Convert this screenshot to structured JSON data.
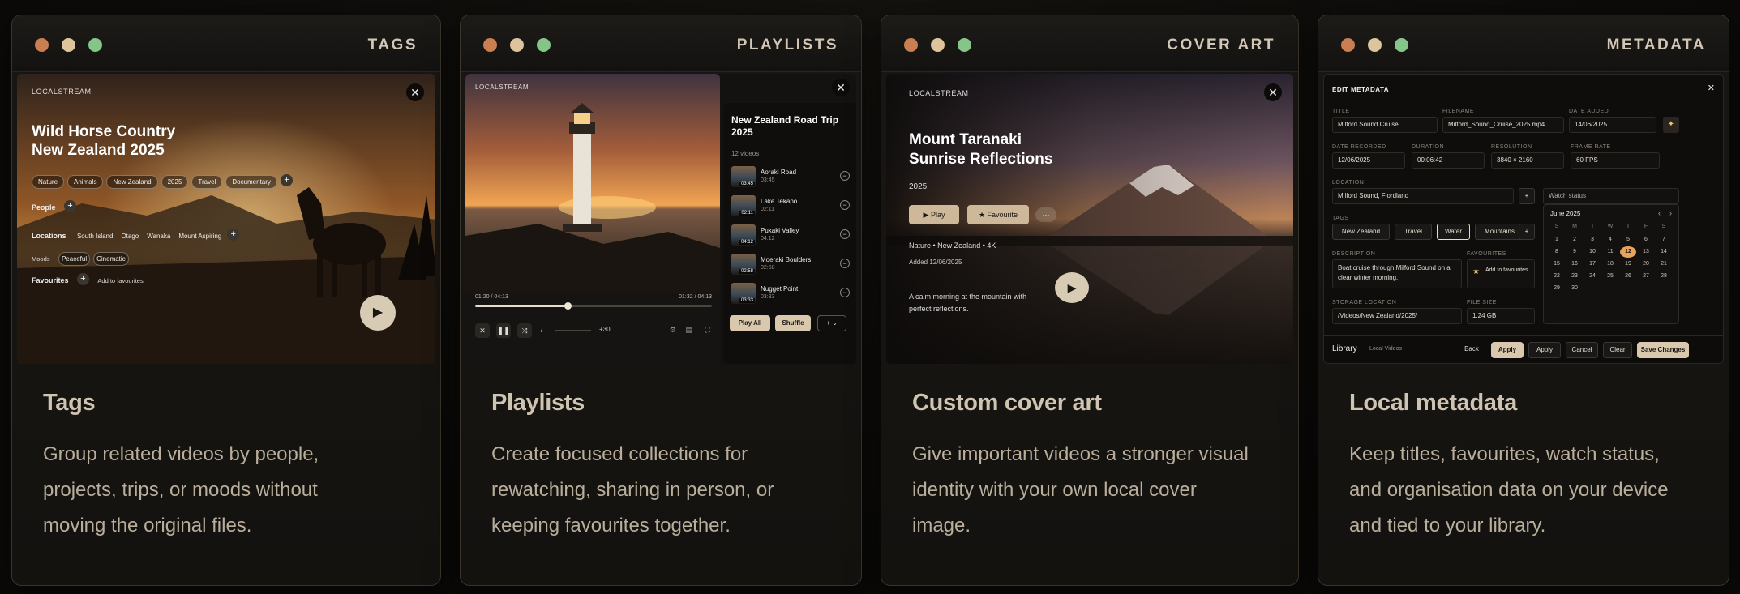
{
  "cards": {
    "tags": {
      "window_title": "TAGS",
      "heading": "Tags",
      "description": "Group related videos by people, projects, trips, or moods without moving the original files.",
      "app_name": "LOCALSTREAM",
      "video_title_line1": "Wild Horse Country",
      "video_title_line2": "New Zealand 2025",
      "tag_chips": [
        "Nature",
        "Animals",
        "New Zealand",
        "2025",
        "Travel",
        "Documentary"
      ],
      "people_label": "People",
      "locations_label": "Locations",
      "locations": [
        "South Island",
        "Otago",
        "Wanaka",
        "Mount Aspiring"
      ],
      "moods_label": "Moods",
      "moods": [
        "Peaceful",
        "Cinematic"
      ],
      "favourites_label": "Favourites",
      "add_to_favourites": "Add to favourites",
      "close_glyph": "✕",
      "plus_glyph": "+",
      "play_glyph": "▶"
    },
    "playlists": {
      "window_title": "PLAYLISTS",
      "heading": "Playlists",
      "description": "Create focused collections for rewatching, sharing in person, or keeping favourites together.",
      "app_name": "LOCALSTREAM",
      "playlist_title_line1": "New Zealand Road Trip",
      "playlist_title_line2": "2025",
      "video_count": "12 videos",
      "items": [
        {
          "name": "Aoraki Road",
          "duration": "03:45",
          "badge": "03:45"
        },
        {
          "name": "Lake Tekapo",
          "duration": "02:11",
          "badge": "02:11"
        },
        {
          "name": "Pukaki Valley",
          "duration": "04:12",
          "badge": "04:12"
        },
        {
          "name": "Moeraki Boulders",
          "duration": "02:58",
          "badge": "02:58"
        },
        {
          "name": "Nugget Point",
          "duration": "03:33",
          "badge": "03:33"
        }
      ],
      "time_current": "01:20 / 04:13",
      "time_right": "01:32 / 04:13",
      "progress_fraction": 0.39,
      "skip_label": "+30",
      "play_all": "Play All",
      "shuffle": "Shuffle",
      "more_label": "+ ⌄",
      "close_glyph": "✕",
      "minus_glyph": "−"
    },
    "cover_art": {
      "window_title": "COVER ART",
      "heading": "Custom cover art",
      "description": "Give important videos a stronger visual identity with your own local cover image.",
      "app_name": "LOCALSTREAM",
      "video_title_line1": "Mount Taranaki",
      "video_title_line2": "Sunrise Reflections",
      "year": "2025",
      "play_button": "▶  Play",
      "favourite_button": "★  Favourite",
      "more_button": "···",
      "meta_line": "Nature  •  New Zealand  •  4K",
      "added": "Added 12/06/2025",
      "blurb": "A calm morning at the mountain with perfect reflections.",
      "close_glyph": "✕",
      "play_glyph": "▶"
    },
    "metadata": {
      "window_title": "METADATA",
      "heading": "Local metadata",
      "description": "Keep titles, favourites, watch status, and organisation data on your device and tied to your library.",
      "panel_title": "EDIT METADATA",
      "close_glyph": "✕",
      "title_label": "TITLE",
      "title_value": "Milford Sound Cruise",
      "filename_label": "FILENAME",
      "filename_value": "Milford_Sound_Cruise_2025.mp4",
      "date_added_label": "DATE ADDED",
      "date_added_value": "14/06/2025",
      "date_recorded_label": "DATE RECORDED",
      "date_recorded_value": "12/06/2025",
      "duration_label": "DURATION",
      "duration_value": "00:06:42",
      "resolution_label": "RESOLUTION",
      "resolution_value": "3840 × 2160",
      "frame_rate_label": "FRAME RATE",
      "frame_rate_value": "60 FPS",
      "location_label": "LOCATION",
      "location_value": "Milford Sound, Fiordland",
      "watch_status": "Watch status",
      "tags_label": "TAGS",
      "tags": [
        "New Zealand",
        "Travel",
        "Water",
        "Mountains"
      ],
      "description_label": "DESCRIPTION",
      "description_value": "Boat cruise through Milford Sound on a clear winter morning.",
      "favourites_label": "FAVOURITES",
      "add_to_favourites": "Add to favourites",
      "storage_label": "STORAGE LOCATION",
      "storage_value": "/Videos/New Zealand/2025/",
      "file_size_label": "FILE SIZE",
      "file_size_value": "1.24 GB",
      "calendar_month": "June 2025",
      "calendar_headers": [
        "S",
        "M",
        "T",
        "W",
        "T",
        "F",
        "S"
      ],
      "calendar_days": [
        "1",
        "2",
        "3",
        "4",
        "5",
        "6",
        "7",
        "8",
        "9",
        "10",
        "11",
        "12",
        "13",
        "14",
        "15",
        "16",
        "17",
        "18",
        "19",
        "20",
        "21",
        "22",
        "23",
        "24",
        "25",
        "26",
        "27",
        "28",
        "29",
        "30"
      ],
      "calendar_selected": "12",
      "library_label": "Library",
      "local_videos": "Local Videos",
      "back": "Back",
      "apply_primary": "Apply",
      "apply": "Apply",
      "cancel": "Cancel",
      "clear": "Clear",
      "save_changes": "Save Changes",
      "plus_glyph": "+"
    }
  }
}
